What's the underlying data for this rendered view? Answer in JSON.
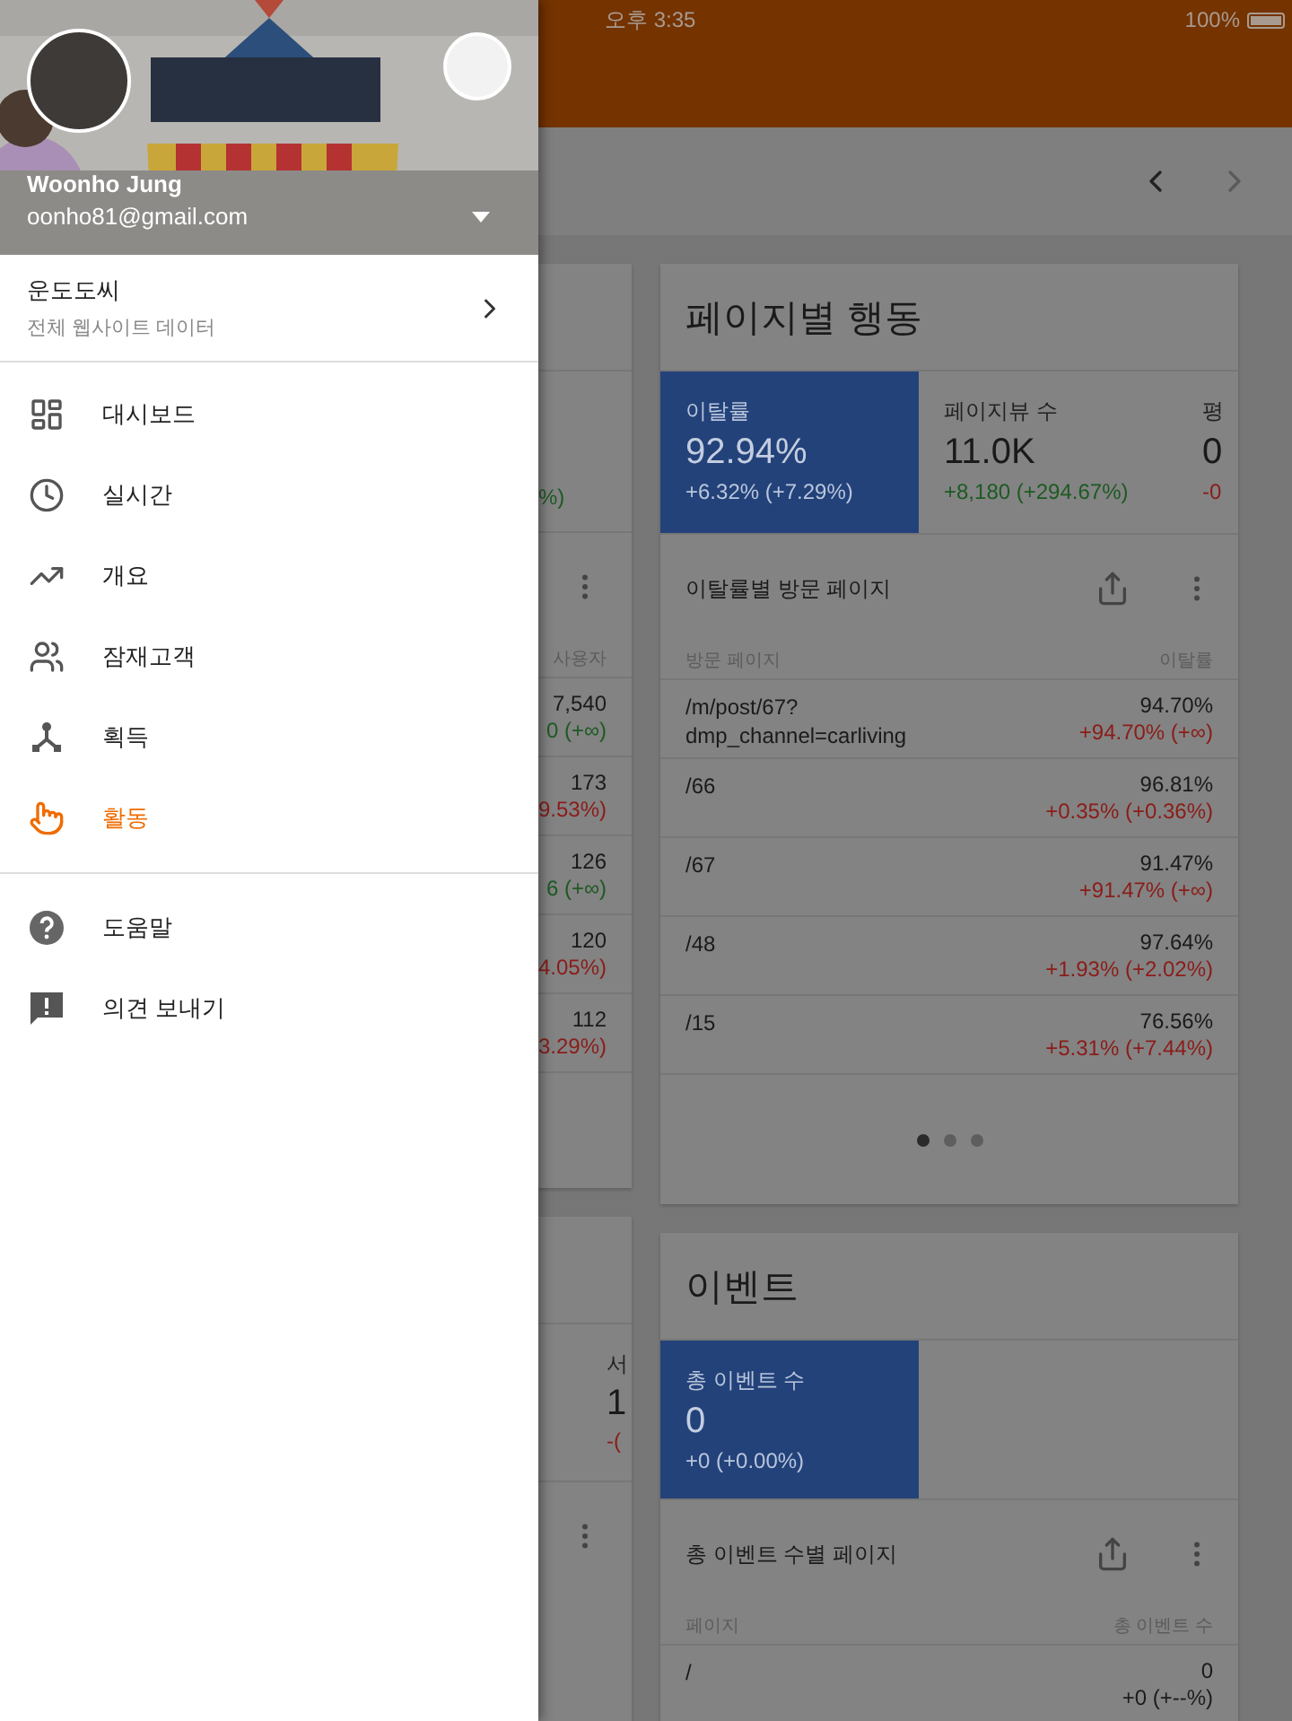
{
  "status_bar": {
    "time": "오후 3:35",
    "battery": "100%"
  },
  "drawer": {
    "account": {
      "name": "Woonho Jung",
      "email": "oonho81@gmail.com"
    },
    "property": {
      "name": "운도도씨",
      "subtitle": "전체 웹사이트 데이터"
    },
    "nav_items": [
      {
        "label": "대시보드",
        "selected": false
      },
      {
        "label": "실시간",
        "selected": false
      },
      {
        "label": "개요",
        "selected": false
      },
      {
        "label": "잠재고객",
        "selected": false
      },
      {
        "label": "획득",
        "selected": false
      },
      {
        "label": "활동",
        "selected": true
      }
    ],
    "footer_items": [
      {
        "label": "도움말"
      },
      {
        "label": "의견 보내기"
      }
    ]
  },
  "left_card_partial": {
    "metric_change": "%)",
    "column_header": "사용자",
    "rows": [
      {
        "value": "7,540",
        "change": "0 (+∞)",
        "color": "#1d5a22"
      },
      {
        "value": "173",
        "change": "9.53%)",
        "color": "#8a1c18"
      },
      {
        "value": "126",
        "change": "6 (+∞)",
        "color": "#1d5a22"
      },
      {
        "value": "120",
        "change": "4.05%)",
        "color": "#8a1c18"
      },
      {
        "value": "112",
        "change": "3.29%)",
        "color": "#8a1c18"
      }
    ],
    "lower_metric": {
      "label": "서",
      "value": "1",
      "change": "-(",
      "color": "#8a1c18"
    }
  },
  "behavior_card": {
    "title": "페이지별 행동",
    "metrics": [
      {
        "label": "이탈률",
        "value": "92.94%",
        "change": "+6.32% (+7.29%)",
        "selected": true
      },
      {
        "label": "페이지뷰 수",
        "value": "11.0K",
        "change": "+8,180 (+294.67%)",
        "color": "#1d5a22",
        "selected": false
      },
      {
        "label": "평",
        "value": "0",
        "change": "-0",
        "color": "#8a1c18",
        "selected": false
      }
    ],
    "table": {
      "title": "이탈률별 방문 페이지",
      "columns": [
        "방문 페이지",
        "이탈률"
      ],
      "rows": [
        {
          "page": "/m/post/67?\ndmp_channel=carliving",
          "value": "94.70%",
          "change": "+94.70% (+∞)",
          "color": "#8a1c18"
        },
        {
          "page": "/66",
          "value": "96.81%",
          "change": "+0.35% (+0.36%)",
          "color": "#8a1c18"
        },
        {
          "page": "/67",
          "value": "91.47%",
          "change": "+91.47% (+∞)",
          "color": "#8a1c18"
        },
        {
          "page": "/48",
          "value": "97.64%",
          "change": "+1.93% (+2.02%)",
          "color": "#8a1c18"
        },
        {
          "page": "/15",
          "value": "76.56%",
          "change": "+5.31% (+7.44%)",
          "color": "#8a1c18"
        }
      ]
    },
    "pager": [
      {
        "selected": true
      },
      {
        "selected": false
      },
      {
        "selected": false
      }
    ]
  },
  "events_card": {
    "title": "이벤트",
    "metrics": [
      {
        "label": "총 이벤트 수",
        "value": "0",
        "change": "+0 (+0.00%)",
        "selected": true
      }
    ],
    "table": {
      "title": "총 이벤트 수별 페이지",
      "columns": [
        "페이지",
        "총 이벤트 수"
      ],
      "rows": [
        {
          "page": "/",
          "value": "0",
          "change": "+0 (+--%)",
          "color": "#1c1c1c"
        }
      ]
    }
  }
}
